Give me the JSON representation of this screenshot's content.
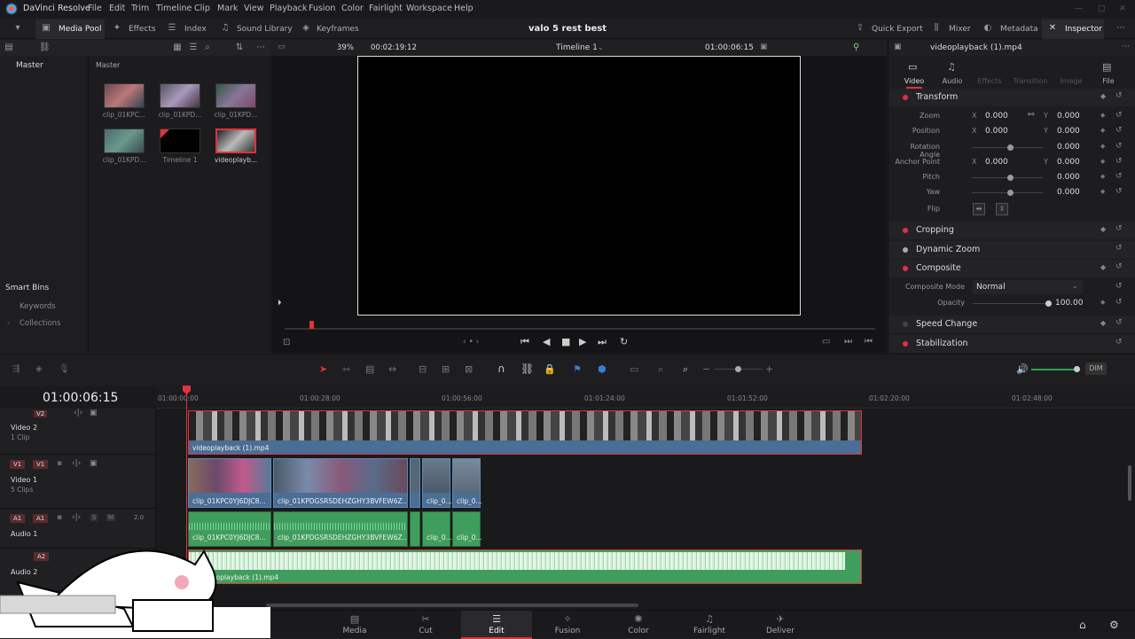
{
  "app": {
    "name": "DaVinci Resolve",
    "project_title": "valo 5 rest best"
  },
  "menu": [
    "File",
    "Edit",
    "Trim",
    "Timeline",
    "Clip",
    "Mark",
    "View",
    "Playback",
    "Fusion",
    "Color",
    "Fairlight",
    "Workspace",
    "Help"
  ],
  "toolbar": {
    "media_pool": "Media Pool",
    "effects": "Effects",
    "index": "Index",
    "sound_library": "Sound Library",
    "keyframes": "Keyframes",
    "quick_export": "Quick Export",
    "mixer": "Mixer",
    "metadata": "Metadata",
    "inspector": "Inspector"
  },
  "media_pool": {
    "master_label": "Master",
    "bin_label": "Master",
    "smart_bins": "Smart Bins",
    "keywords": "Keywords",
    "collections": "Collections",
    "clips": [
      {
        "label": "clip_01KPC..."
      },
      {
        "label": "clip_01KPD..."
      },
      {
        "label": "clip_01KPD..."
      },
      {
        "label": "clip_01KPD..."
      },
      {
        "label": "Timeline 1"
      },
      {
        "label": "videoplayb..."
      }
    ]
  },
  "viewer": {
    "zoom": "39%",
    "duration": "00:02:19:12",
    "timeline_name": "Timeline 1",
    "timecode": "01:00:06:15"
  },
  "inspector": {
    "clip_name": "videoplayback (1).mp4",
    "tabs": [
      "Video",
      "Audio",
      "Effects",
      "Transition",
      "Image",
      "File"
    ],
    "transform": "Transform",
    "zoom_label": "Zoom",
    "zoom_x": "0.000",
    "zoom_y": "0.000",
    "position_label": "Position",
    "position_x": "0.000",
    "position_y": "0.000",
    "rotation_label": "Rotation Angle",
    "rotation": "0.000",
    "anchor_label": "Anchor Point",
    "anchor_x": "0.000",
    "anchor_y": "0.000",
    "pitch_label": "Pitch",
    "pitch": "0.000",
    "yaw_label": "Yaw",
    "yaw": "0.000",
    "flip_label": "Flip",
    "cropping": "Cropping",
    "dynamic_zoom": "Dynamic Zoom",
    "composite": "Composite",
    "composite_mode_label": "Composite Mode",
    "composite_mode": "Normal",
    "opacity_label": "Opacity",
    "opacity": "100.00",
    "speed_change": "Speed Change",
    "stabilization": "Stabilization",
    "x": "X",
    "y": "Y"
  },
  "timeline": {
    "timecode": "01:00:06:15",
    "dim": "DIM",
    "ruler": [
      "01:00:00:00",
      "01:00:28:00",
      "01:00:56:00",
      "01:01:24:00",
      "01:01:52:00",
      "01:02:20:00",
      "01:02:48:00"
    ],
    "tracks": {
      "v2": "V2",
      "video2": "Video 2",
      "video2_clips": "1 Clip",
      "v1": "V1",
      "video1": "Video 1",
      "video1_clips": "5 Clips",
      "a1": "A1",
      "audio1": "Audio 1",
      "a2": "A2",
      "audio2": "Audio 2",
      "a1_level": "2.0",
      "s": "S",
      "m": "M"
    },
    "clips": {
      "v2_main": "videoplayback (1).mp4",
      "v1_c1": "clip_01KPC0YJ6DJC8...",
      "v1_c2": "clip_01KPDGSRSDEHZGHY3BVFEW6Z...",
      "v1_c3": "clip_0...",
      "v1_c4": "clip_0...",
      "a1_c1": "clip_01KPC0YJ6DJC8...",
      "a1_c2": "clip_01KPDGSRSDEHZGHY3BVFEW6Z...",
      "a1_c3": "clip_0...",
      "a1_c4": "clip_0...",
      "a2_main": "eoplayback (1).mp4"
    }
  },
  "pages": [
    "Media",
    "Cut",
    "Edit",
    "Fusion",
    "Color",
    "Fairlight",
    "Deliver"
  ],
  "active_page": "Edit",
  "colors": {
    "accent": "#e0323c",
    "video_clip": "#4a6e95",
    "audio_clip": "#3f9d5d"
  }
}
